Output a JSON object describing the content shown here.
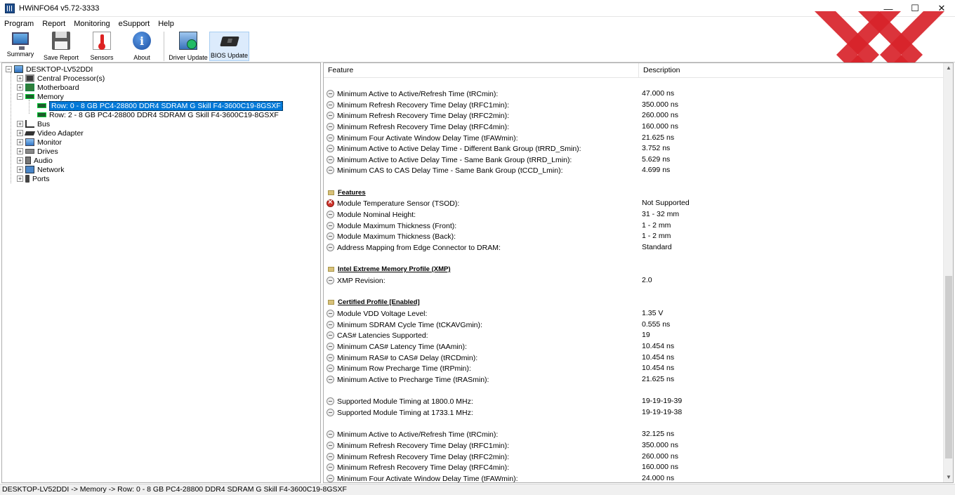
{
  "window": {
    "title": "HWiNFO64 v5.72-3333"
  },
  "menu": [
    "Program",
    "Report",
    "Monitoring",
    "eSupport",
    "Help"
  ],
  "toolbar": {
    "summary": "Summary",
    "save_report": "Save Report",
    "sensors": "Sensors",
    "about": "About",
    "driver_update": "Driver Update",
    "bios_update": "BIOS Update"
  },
  "tree": {
    "root": "DESKTOP-LV52DDI",
    "items": [
      "Central Processor(s)",
      "Motherboard",
      "Memory",
      "Row: 0 - 8 GB PC4-28800 DDR4 SDRAM G Skill F4-3600C19-8GSXF",
      "Row: 2 - 8 GB PC4-28800 DDR4 SDRAM G Skill F4-3600C19-8GSXF",
      "Bus",
      "Video Adapter",
      "Monitor",
      "Drives",
      "Audio",
      "Network",
      "Ports"
    ]
  },
  "list": {
    "headers": {
      "feature": "Feature",
      "description": "Description"
    },
    "rows": [
      {
        "type": "item",
        "feature": "Minimum Active to Active/Refresh Time (tRCmin):",
        "value": "47.000 ns"
      },
      {
        "type": "item",
        "feature": "Minimum Refresh Recovery Time Delay (tRFC1min):",
        "value": "350.000 ns"
      },
      {
        "type": "item",
        "feature": "Minimum Refresh Recovery Time Delay (tRFC2min):",
        "value": "260.000 ns"
      },
      {
        "type": "item",
        "feature": "Minimum Refresh Recovery Time Delay (tRFC4min):",
        "value": "160.000 ns"
      },
      {
        "type": "item",
        "feature": "Minimum Four Activate Window Delay Time (tFAWmin):",
        "value": "21.625 ns"
      },
      {
        "type": "item",
        "feature": "Minimum Active to Active Delay Time - Different Bank Group (tRRD_Smin):",
        "value": "3.752 ns"
      },
      {
        "type": "item",
        "feature": "Minimum Active to Active Delay Time - Same Bank Group (tRRD_Lmin):",
        "value": "5.629 ns"
      },
      {
        "type": "item",
        "feature": "Minimum CAS to CAS Delay Time - Same Bank Group (tCCD_Lmin):",
        "value": "4.699 ns"
      },
      {
        "type": "section",
        "feature": "Features",
        "value": ""
      },
      {
        "type": "error",
        "feature": "Module Temperature Sensor (TSOD):",
        "value": "Not Supported"
      },
      {
        "type": "item",
        "feature": "Module Nominal Height:",
        "value": "31 - 32 mm"
      },
      {
        "type": "item",
        "feature": "Module Maximum Thickness (Front):",
        "value": "1 - 2 mm"
      },
      {
        "type": "item",
        "feature": "Module Maximum Thickness (Back):",
        "value": "1 - 2 mm"
      },
      {
        "type": "item",
        "feature": "Address Mapping from Edge Connector to DRAM:",
        "value": "Standard"
      },
      {
        "type": "section",
        "feature": "Intel Extreme Memory Profile (XMP)",
        "value": ""
      },
      {
        "type": "item",
        "feature": "XMP Revision:",
        "value": "2.0"
      },
      {
        "type": "section",
        "feature": "Certified Profile [Enabled]",
        "value": ""
      },
      {
        "type": "item",
        "feature": "Module VDD Voltage Level:",
        "value": "1.35 V"
      },
      {
        "type": "item",
        "feature": "Minimum SDRAM Cycle Time (tCKAVGmin):",
        "value": "0.555 ns"
      },
      {
        "type": "item",
        "feature": "CAS# Latencies Supported:",
        "value": "19"
      },
      {
        "type": "item",
        "feature": "Minimum CAS# Latency Time (tAAmin):",
        "value": "10.454 ns"
      },
      {
        "type": "item",
        "feature": "Minimum RAS# to CAS# Delay (tRCDmin):",
        "value": "10.454 ns"
      },
      {
        "type": "item",
        "feature": "Minimum Row Precharge Time (tRPmin):",
        "value": "10.454 ns"
      },
      {
        "type": "item",
        "feature": "Minimum Active to Precharge Time (tRASmin):",
        "value": "21.625 ns"
      },
      {
        "type": "item",
        "feature": "Supported Module Timing at 1800.0 MHz:",
        "value": "19-19-19-39"
      },
      {
        "type": "item",
        "feature": "Supported Module Timing at 1733.1 MHz:",
        "value": "19-19-19-38"
      },
      {
        "type": "item",
        "feature": "Minimum Active to Active/Refresh Time (tRCmin):",
        "value": "32.125 ns"
      },
      {
        "type": "item",
        "feature": "Minimum Refresh Recovery Time Delay (tRFC1min):",
        "value": "350.000 ns"
      },
      {
        "type": "item",
        "feature": "Minimum Refresh Recovery Time Delay (tRFC2min):",
        "value": "260.000 ns"
      },
      {
        "type": "item",
        "feature": "Minimum Refresh Recovery Time Delay (tRFC4min):",
        "value": "160.000 ns"
      },
      {
        "type": "item",
        "feature": "Minimum Four Activate Window Delay Time (tFAWmin):",
        "value": "24.000 ns"
      }
    ]
  },
  "statusbar": {
    "path": "DESKTOP-LV52DDI -> Memory -> Row: 0 - 8 GB PC4-28800 DDR4 SDRAM G Skill F4-3600C19-8GSXF"
  },
  "colors": {
    "selection": "#0078d7",
    "logo_red": "#d8232a"
  }
}
